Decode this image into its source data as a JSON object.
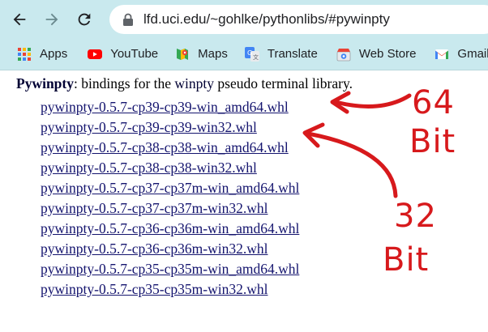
{
  "browser": {
    "url": "lfd.uci.edu/~gohlke/pythonlibs/#pywinpty"
  },
  "bookmarks": [
    {
      "label": "Apps",
      "icon": "apps-grid-icon"
    },
    {
      "label": "YouTube",
      "icon": "youtube-icon"
    },
    {
      "label": "Maps",
      "icon": "maps-icon"
    },
    {
      "label": "Translate",
      "icon": "translate-icon"
    },
    {
      "label": "Web Store",
      "icon": "web-store-icon"
    },
    {
      "label": "Gmail",
      "icon": "gmail-icon"
    }
  ],
  "page": {
    "package_name": "Pywinpty",
    "desc_before": ": bindings for the ",
    "desc_link": "winpty",
    "desc_after": " pseudo terminal library.",
    "files": [
      "pywinpty-0.5.7-cp39-cp39-win_amd64.whl",
      "pywinpty-0.5.7-cp39-cp39-win32.whl",
      "pywinpty-0.5.7-cp38-cp38-win_amd64.whl",
      "pywinpty-0.5.7-cp38-cp38-win32.whl",
      "pywinpty-0.5.7-cp37-cp37m-win_amd64.whl",
      "pywinpty-0.5.7-cp37-cp37m-win32.whl",
      "pywinpty-0.5.7-cp36-cp36m-win_amd64.whl",
      "pywinpty-0.5.7-cp36-cp36m-win32.whl",
      "pywinpty-0.5.7-cp35-cp35m-win_amd64.whl",
      "pywinpty-0.5.7-cp35-cp35m-win32.whl"
    ]
  },
  "annotations": {
    "a64": "64",
    "bit1": "Bit",
    "a32": "32",
    "bit2": "Bit",
    "color": "#d7191c"
  }
}
